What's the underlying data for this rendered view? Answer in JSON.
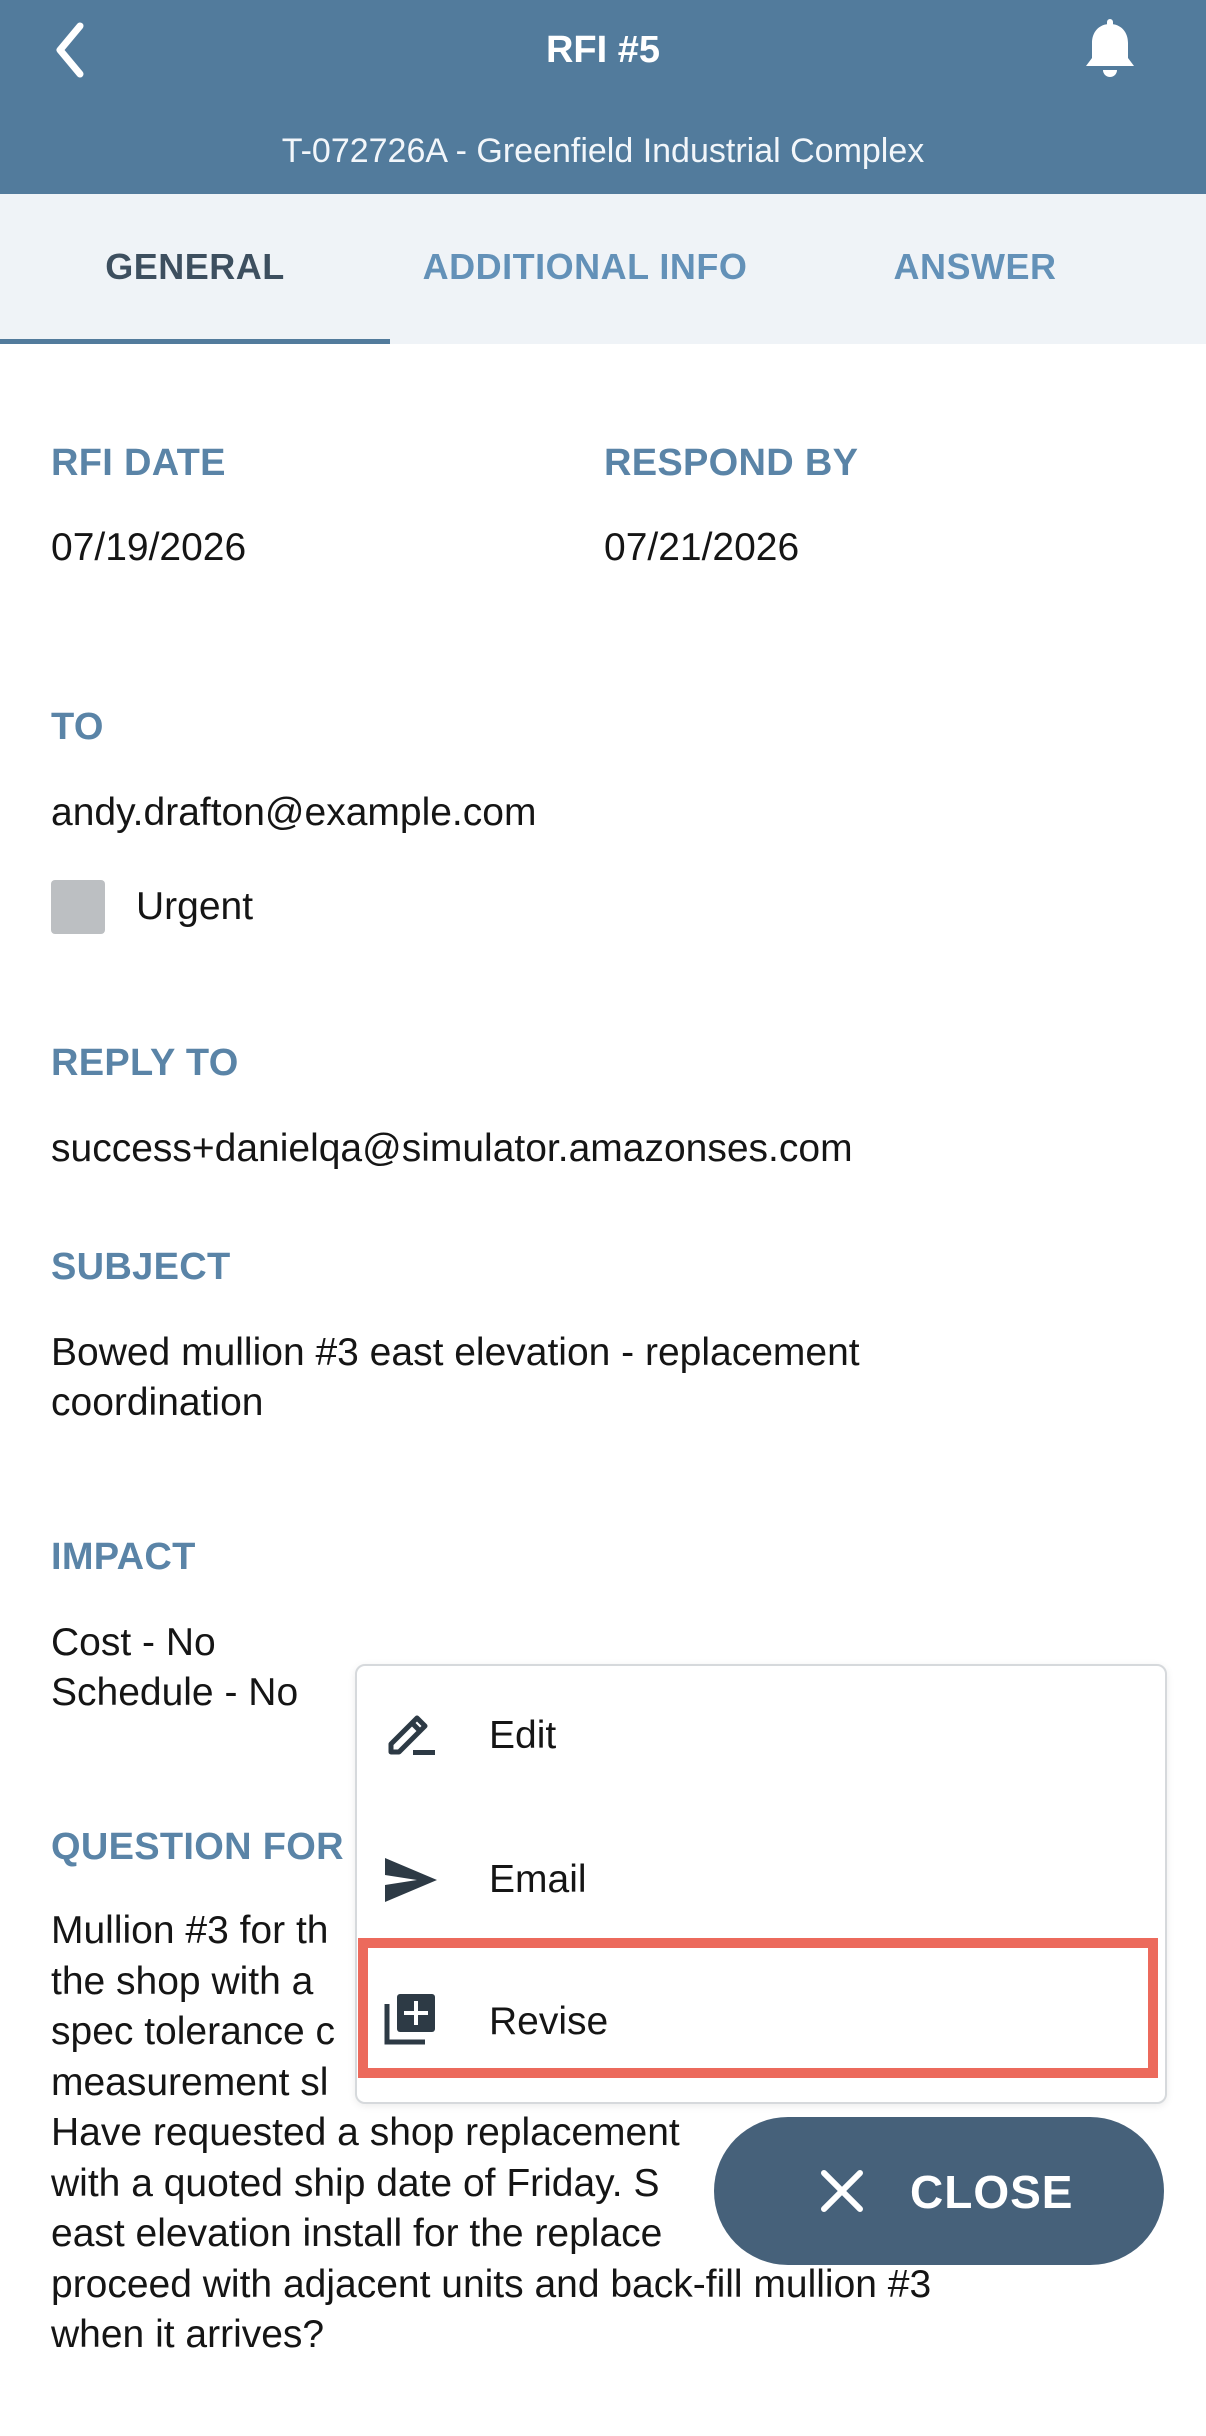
{
  "header": {
    "title": "RFI #5",
    "subtitle": "T-072726A - Greenfield Industrial Complex",
    "back_icon": "chevron-left-icon",
    "notification_icon": "bell-icon"
  },
  "tabs": [
    {
      "label": "GENERAL",
      "active": true
    },
    {
      "label": "ADDITIONAL INFO",
      "active": false
    },
    {
      "label": "ANSWER",
      "active": false
    }
  ],
  "fields": {
    "rfi_date_label": "RFI DATE",
    "rfi_date_value": "07/19/2026",
    "respond_by_label": "RESPOND BY",
    "respond_by_value": "07/21/2026",
    "to_label": "TO",
    "to_value": "andy.drafton@example.com",
    "urgent_label": "Urgent",
    "reply_to_label": "REPLY TO",
    "reply_to_value": "success+danielqa@simulator.amazonses.com",
    "subject_label": "SUBJECT",
    "subject_line1": "Bowed mullion #3 east elevation - replacement",
    "subject_line2": "coordination",
    "impact_label": "IMPACT",
    "impact_cost": "Cost - No",
    "impact_schedule": "Schedule - No",
    "question_label": "QUESTION FOR",
    "question_lines": [
      "Mullion #3 for th",
      "the shop with a",
      "spec tolerance c",
      "measurement sl",
      "Have requested a shop replacement",
      "with a quoted ship date of Friday. S",
      "east elevation install for the replace",
      "proceed with adjacent units and back-fill mullion #3",
      "when it arrives?"
    ]
  },
  "menu": {
    "items": [
      {
        "label": "Edit",
        "icon": "pencil-icon"
      },
      {
        "label": "Email",
        "icon": "send-icon"
      },
      {
        "label": "Revise",
        "icon": "add-document-icon"
      }
    ]
  },
  "close_button": {
    "label": "CLOSE",
    "icon": "close-icon"
  },
  "colors": {
    "header": "#527b9c",
    "label": "#5a84a7",
    "fab": "#46617a",
    "highlight": "#ec6a5c"
  }
}
